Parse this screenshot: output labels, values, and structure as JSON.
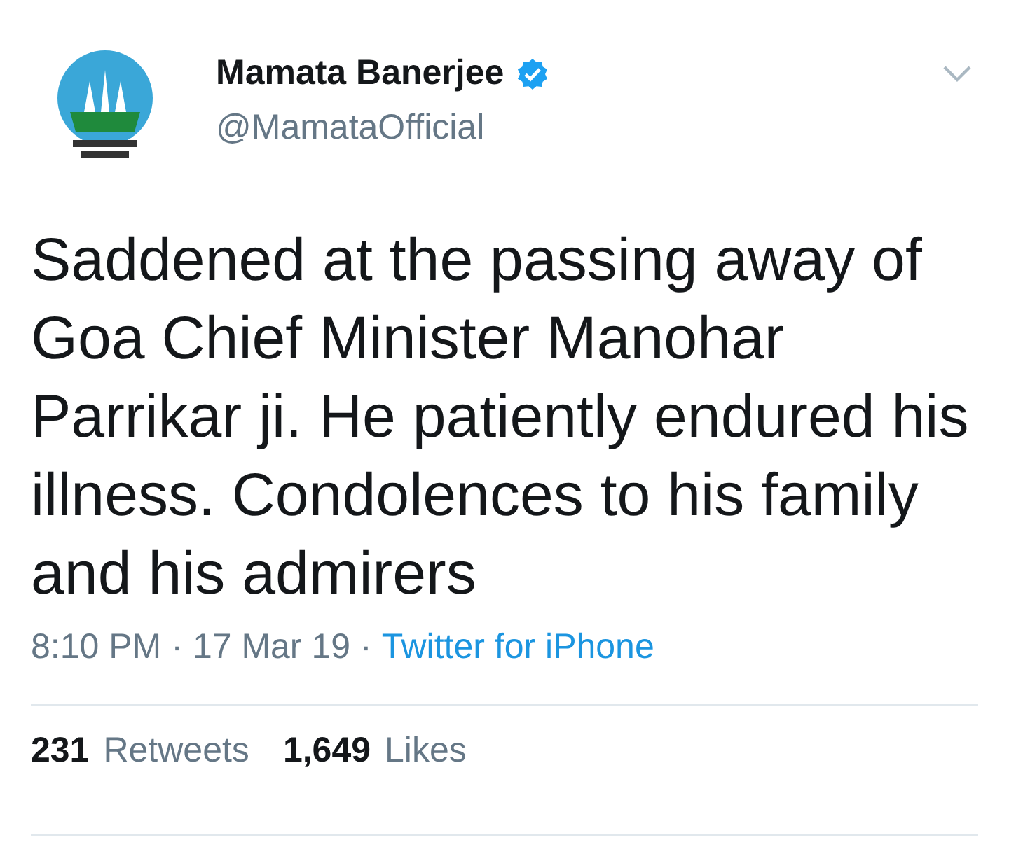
{
  "author": {
    "name": "Mamata Banerjee",
    "verified": true,
    "handle": "@MamataOfficial"
  },
  "text": "Saddened at the passing away of Goa Chief Minister Manohar Parrikar ji. He patiently endured his illness. Condolences to his family and his admirers",
  "time": "8:10 PM",
  "separator": "·",
  "date": "17 Mar 19",
  "separator_2": "·",
  "source": "Twitter for iPhone",
  "stats": [
    {
      "count": "231",
      "label": "Retweets"
    },
    {
      "count": "1,649",
      "label": "Likes"
    }
  ]
}
